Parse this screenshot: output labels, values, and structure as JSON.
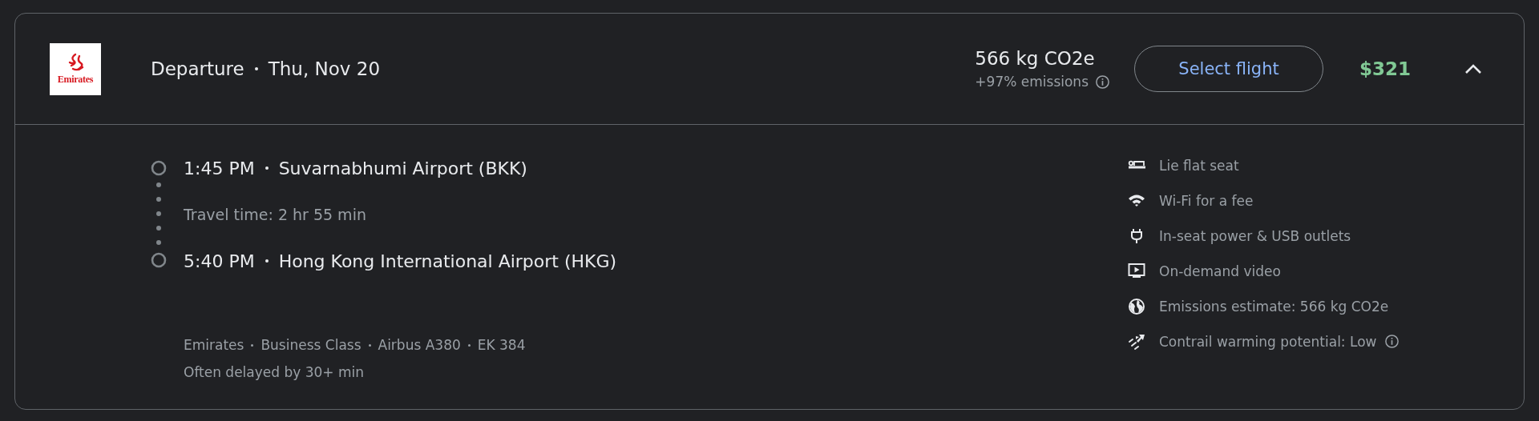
{
  "header": {
    "logo_text": "Emirates",
    "title": "Departure",
    "date": "Thu, Nov 20",
    "emissions": "566 kg CO2e",
    "emissions_delta": "+97% emissions",
    "button": "Select flight",
    "price": "$321",
    "expanded": true
  },
  "itinerary": {
    "stops": [
      {
        "time": "1:45 PM",
        "airport": "Suvarnabhumi Airport (BKK)"
      },
      {
        "time": "5:40 PM",
        "airport": "Hong Kong International Airport (HKG)"
      }
    ],
    "travel_time": "Travel time: 2 hr 55 min",
    "details": [
      "Emirates",
      "Business Class",
      "Airbus A380",
      "EK 384"
    ],
    "delay_note": "Often delayed by 30+ min"
  },
  "amenities": [
    {
      "kind": "seat",
      "label": "Lie flat seat",
      "info": false
    },
    {
      "kind": "wifi",
      "label": "Wi-Fi for a fee",
      "info": false
    },
    {
      "kind": "power",
      "label": "In-seat power & USB outlets",
      "info": false
    },
    {
      "kind": "video",
      "label": "On-demand video",
      "info": false
    },
    {
      "kind": "globe",
      "label": "Emissions estimate: 566 kg CO2e",
      "info": false
    },
    {
      "kind": "contrail",
      "label": "Contrail warming potential: Low",
      "info": true
    }
  ]
}
